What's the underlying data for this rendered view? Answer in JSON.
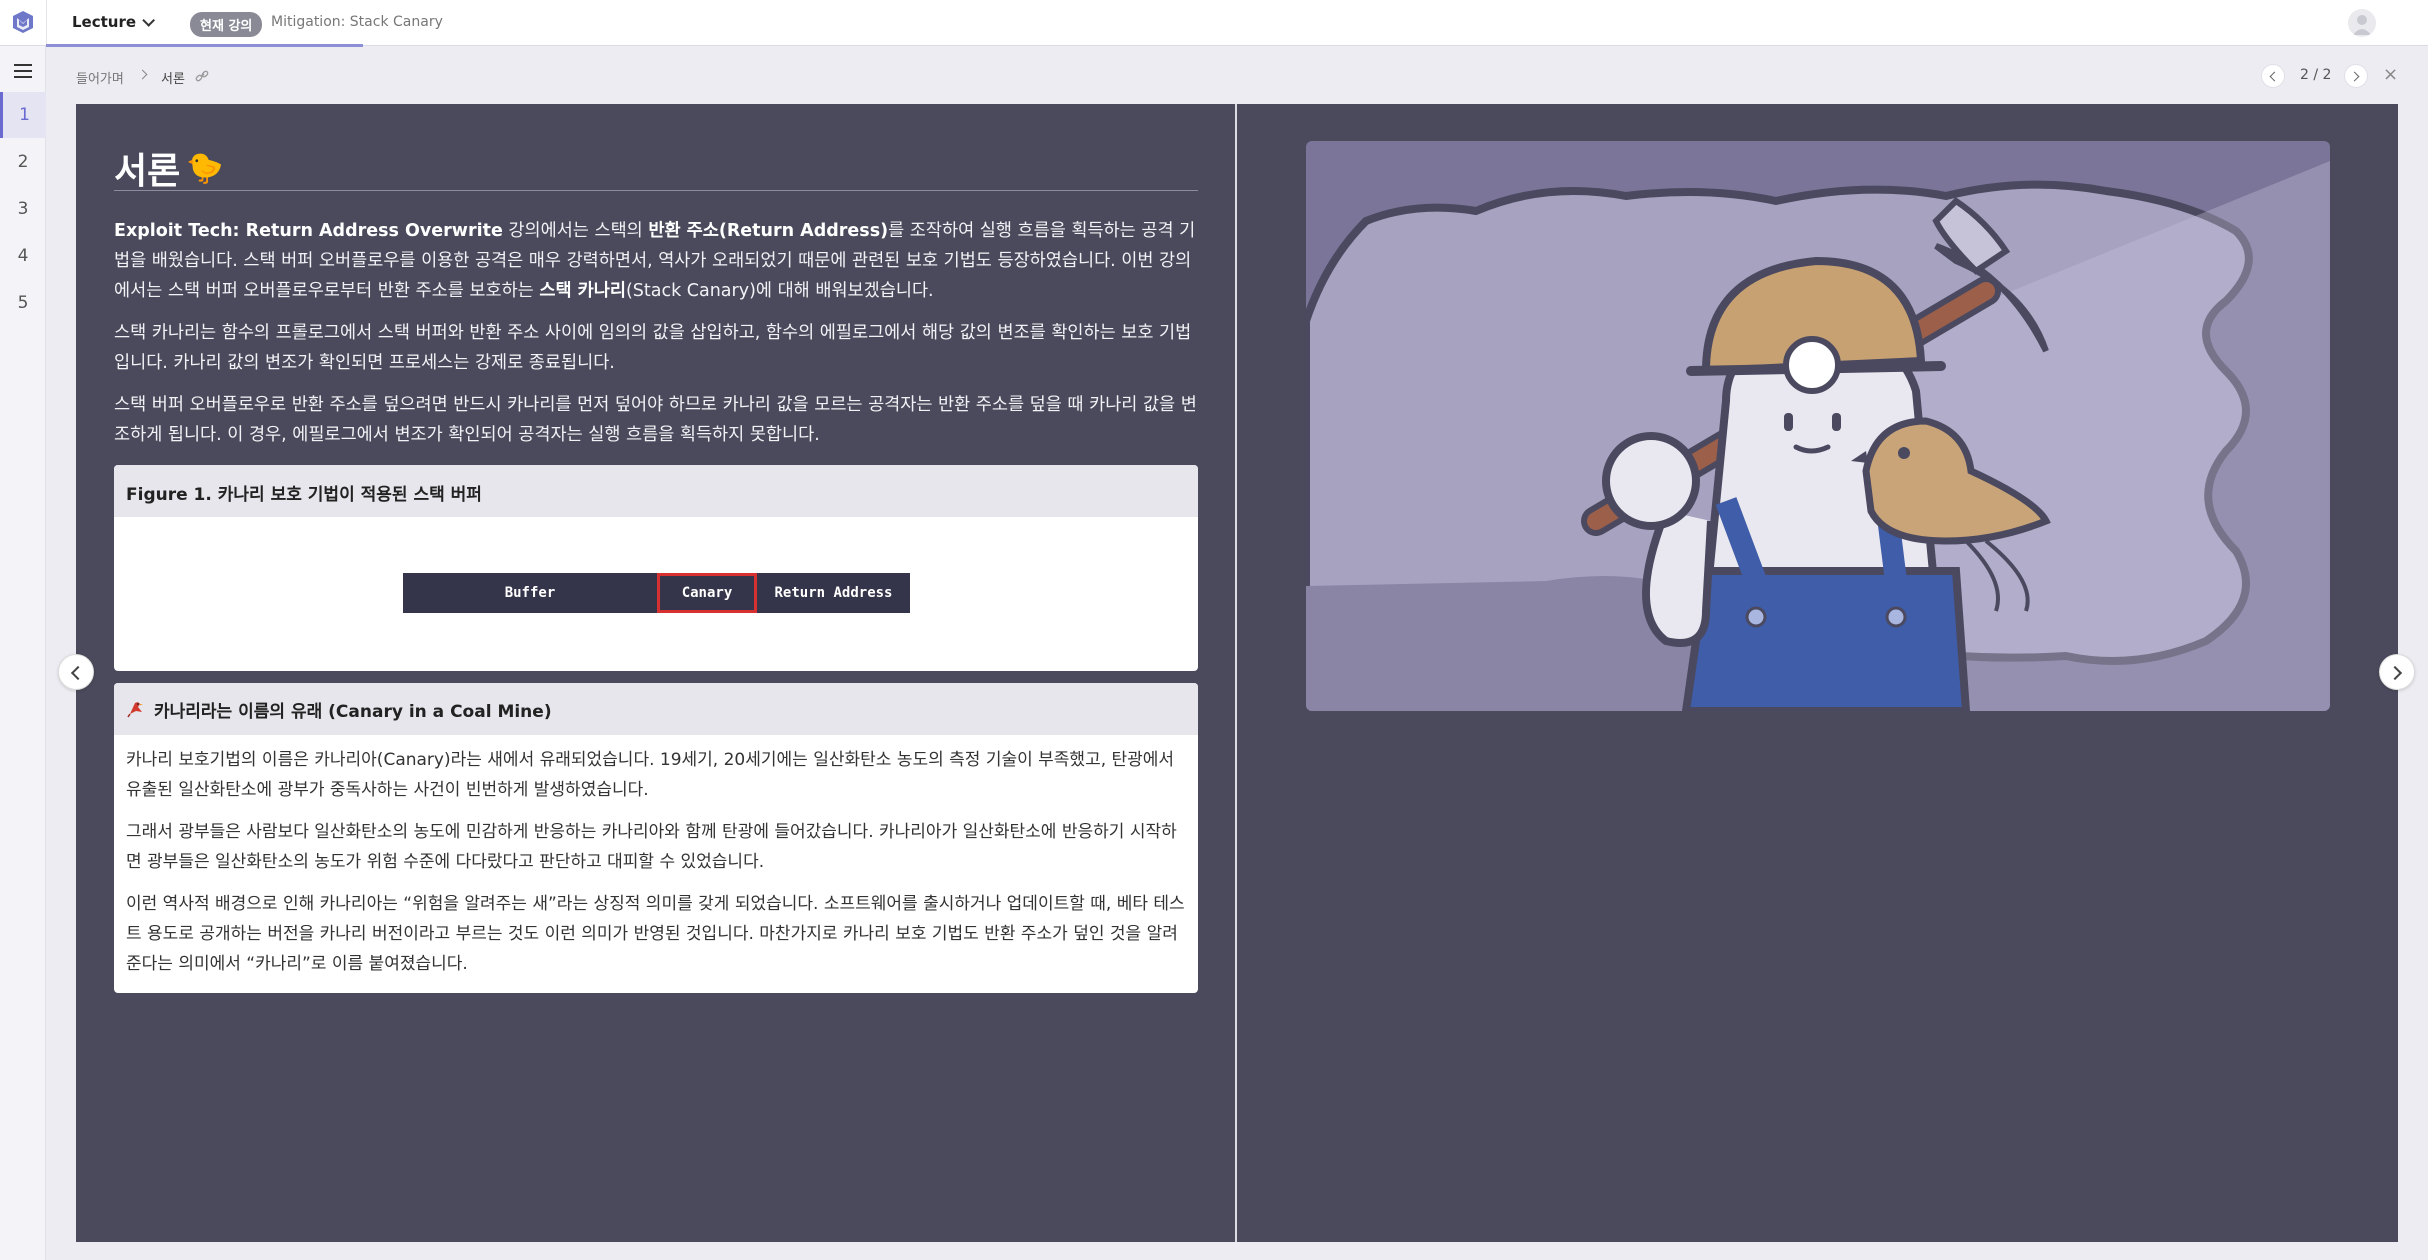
{
  "topbar": {
    "menu_label": "Lecture",
    "current_badge": "현재 강의",
    "current_title": "Mitigation: Stack Canary"
  },
  "sidebar": {
    "pages": [
      "1",
      "2",
      "3",
      "4",
      "5"
    ],
    "active_page": "1"
  },
  "breadcrumb": {
    "parent": "들어가며",
    "current": "서론"
  },
  "pager": {
    "counter": "2 / 2",
    "close": "×"
  },
  "slide": {
    "title": "서론",
    "title_emoji": "🐤",
    "paragraphs": [
      {
        "parts": [
          {
            "t": "Exploit Tech: Return Address Overwrite",
            "b": true
          },
          {
            "t": " 강의에서는 스택의 ",
            "b": false
          },
          {
            "t": "반환 주소(Return Address)",
            "b": true
          },
          {
            "t": "를 조작하여 실행 흐름을 획득하는 공격 기법을 배웠습니다. 스택 버퍼 오버플로우를 이용한 공격은 매우 강력하면서, 역사가 오래되었기 때문에 관련된 보호 기법도 등장하였습니다. 이번 강의에서는 스택 버퍼 오버플로우로부터 반환 주소를 보호하는 ",
            "b": false
          },
          {
            "t": "스택 카나리",
            "b": true
          },
          {
            "t": "(Stack Canary)에 대해 배워보겠습니다.",
            "b": false
          }
        ]
      },
      {
        "parts": [
          {
            "t": "스택 카나리는 함수의 프롤로그에서 스택 버퍼와 반환 주소 사이에 임의의 값을 삽입하고, 함수의 에필로그에서 해당 값의 변조를 확인하는 보호 기법입니다. 카나리 값의 변조가 확인되면 프로세스는 강제로 종료됩니다.",
            "b": false
          }
        ]
      },
      {
        "parts": [
          {
            "t": "스택 버퍼 오버플로우로 반환 주소를 덮으려면 반드시 카나리를 먼저 덮어야 하므로 카나리 값을 모르는 공격자는 반환 주소를 덮을 때 카나리 값을 변조하게 됩니다. 이 경우, 에필로그에서 변조가 확인되어 공격자는 실행 흐름을 획득하지 못합니다.",
            "b": false
          }
        ]
      }
    ],
    "figure": {
      "title": "Figure 1. 카나리 보호 기법이 적용된 스택 버퍼",
      "cells": [
        "Buffer",
        "Canary",
        "Return Address"
      ],
      "highlight_color": "#d63030"
    },
    "note": {
      "icon": "bird-icon",
      "title": "카나리라는 이름의 유래 (Canary in a Coal Mine)",
      "paragraphs": [
        "카나리 보호기법의 이름은 카나리아(Canary)라는 새에서 유래되었습니다. 19세기, 20세기에는 일산화탄소 농도의 측정 기술이 부족했고, 탄광에서 유출된 일산화탄소에 광부가 중독사하는 사건이 빈번하게 발생하였습니다.",
        "그래서 광부들은 사람보다 일산화탄소의 농도에 민감하게 반응하는 카나리아와 함께 탄광에 들어갔습니다. 카나리아가 일산화탄소에 반응하기 시작하면 광부들은 일산화탄소의 농도가 위험 수준에 다다랐다고 판단하고 대피할 수 있었습니다.",
        "이런 역사적 배경으로 인해 카나리아는 “위험을 알려주는 새”라는 상징적 의미를 갖게 되었습니다. 소프트웨어를 출시하거나 업데이트할 때, 베타 테스트 용도로 공개하는 버전을 카나리 버전이라고 부르는 것도 이런 의미가 반영된 것입니다. 마찬가지로 카나리 보호 기법도 반환 주소가 덮인 것을 알려준다는 의미에서 “카나리”로 이름 붙여졌습니다."
      ]
    }
  },
  "colors": {
    "slide_bg": "#4a4a5c",
    "accent": "#6a6ad0",
    "illustration_bg": "#7b7599"
  }
}
